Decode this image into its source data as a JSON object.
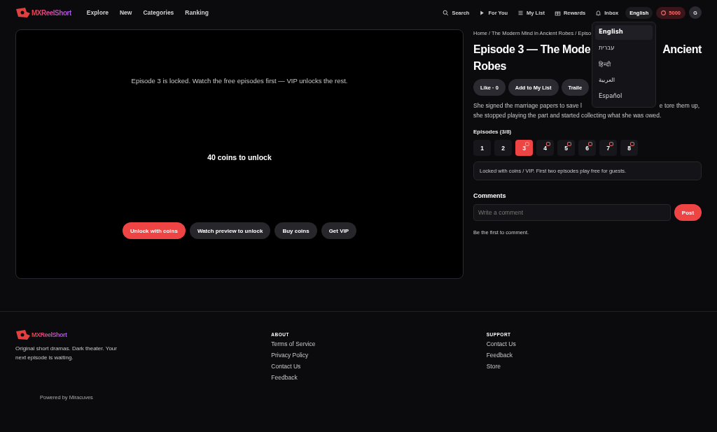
{
  "header": {
    "logo": "MXReelShort",
    "nav": [
      "Explore",
      "New",
      "Categories",
      "Ranking"
    ],
    "actions": [
      {
        "kind": "search",
        "label": "Search"
      },
      {
        "kind": "play",
        "label": "For You"
      },
      {
        "kind": "list",
        "label": "My List"
      },
      {
        "kind": "gift",
        "label": "Rewards"
      },
      {
        "kind": "bell",
        "label": "Inbox"
      }
    ],
    "language": "English",
    "coins": "5000",
    "avatar": "G"
  },
  "language_menu": [
    {
      "label": "English",
      "selected": true
    },
    {
      "label": "עברית",
      "selected": false
    },
    {
      "label": "हिन्दी",
      "selected": false
    },
    {
      "label": "العربية",
      "selected": false
    },
    {
      "label": "Español",
      "selected": false
    }
  ],
  "player": {
    "message": "Episode 3 is locked. Watch the free episodes first — VIP unlocks the rest.",
    "price": "40 coins to unlock",
    "buttons": [
      {
        "label": "Unlock with coins",
        "primary": true
      },
      {
        "label": "Watch preview to unlock",
        "primary": false
      },
      {
        "label": "Buy coins",
        "primary": false
      },
      {
        "label": "Get VIP",
        "primary": false
      }
    ]
  },
  "breadcrumb": "Home / The Modern Mind in Ancient Robes / Episo",
  "title_parts": [
    "Episode 3 — The Mode",
    "Ancient",
    "Robes"
  ],
  "actions": [
    "Like · 0",
    "Add to My List",
    "Traile"
  ],
  "description_parts": [
    "She signed the marriage papers to save l",
    "e tore them up,",
    "she stopped playing the part and started collecting what she was owed."
  ],
  "episodes_label": "Episodes (3/8)",
  "episodes": [
    {
      "number": "1",
      "selected": false,
      "locked": false
    },
    {
      "number": "2",
      "selected": false,
      "locked": false
    },
    {
      "number": "3",
      "selected": true,
      "locked": true
    },
    {
      "number": "4",
      "selected": false,
      "locked": true
    },
    {
      "number": "5",
      "selected": false,
      "locked": true
    },
    {
      "number": "6",
      "selected": false,
      "locked": true
    },
    {
      "number": "7",
      "selected": false,
      "locked": true
    },
    {
      "number": "8",
      "selected": false,
      "locked": true
    }
  ],
  "notice": "Locked with coins / VIP. First two episodes play free for guests.",
  "comments": {
    "heading": "Comments",
    "placeholder": "Write a comment",
    "post": "Post",
    "empty": "Be the first to comment."
  },
  "footer": {
    "logo": "MXReelShort",
    "tagline": "Original short dramas. Dark theater. Your next episode is waiting.",
    "powered": "Powered by Miracuves",
    "columns": [
      {
        "heading": "ABOUT",
        "links": [
          "Terms of Service",
          "Privacy Policy",
          "Contact Us",
          "Feedback"
        ]
      },
      {
        "heading": "SUPPORT",
        "links": [
          "Contact Us",
          "Feedback",
          "Store"
        ]
      }
    ]
  }
}
